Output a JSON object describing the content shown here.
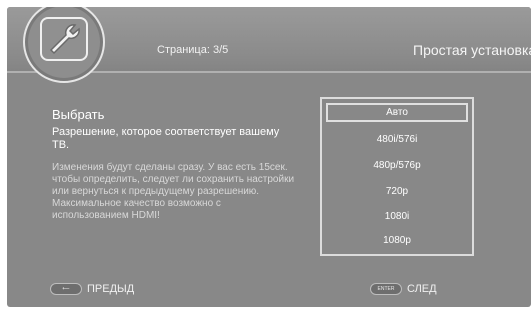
{
  "header": {
    "page_indicator": "Страница: 3/5",
    "title": "Простая установка",
    "icon": "wrench-icon"
  },
  "content": {
    "heading": "Выбрать",
    "description": "Разрешение, которое соответствует вашему ТВ.",
    "note": "Изменения будут сделаны сразу. У вас есть 15сек. чтобы определить, следует ли сохранить настройки или вернуться к предыдущему разрешению. Максимальное качество возможно с использованием HDMI!"
  },
  "options": {
    "items": [
      "Авто",
      "480i/576i",
      "480p/576p",
      "720p",
      "1080i",
      "1080p"
    ],
    "selected_index": 0
  },
  "footer": {
    "prev_button_glyph": "⟵",
    "prev_label": "ПРЕДЫД",
    "next_button_glyph": "ENTER",
    "next_label": "СЛЕД"
  }
}
